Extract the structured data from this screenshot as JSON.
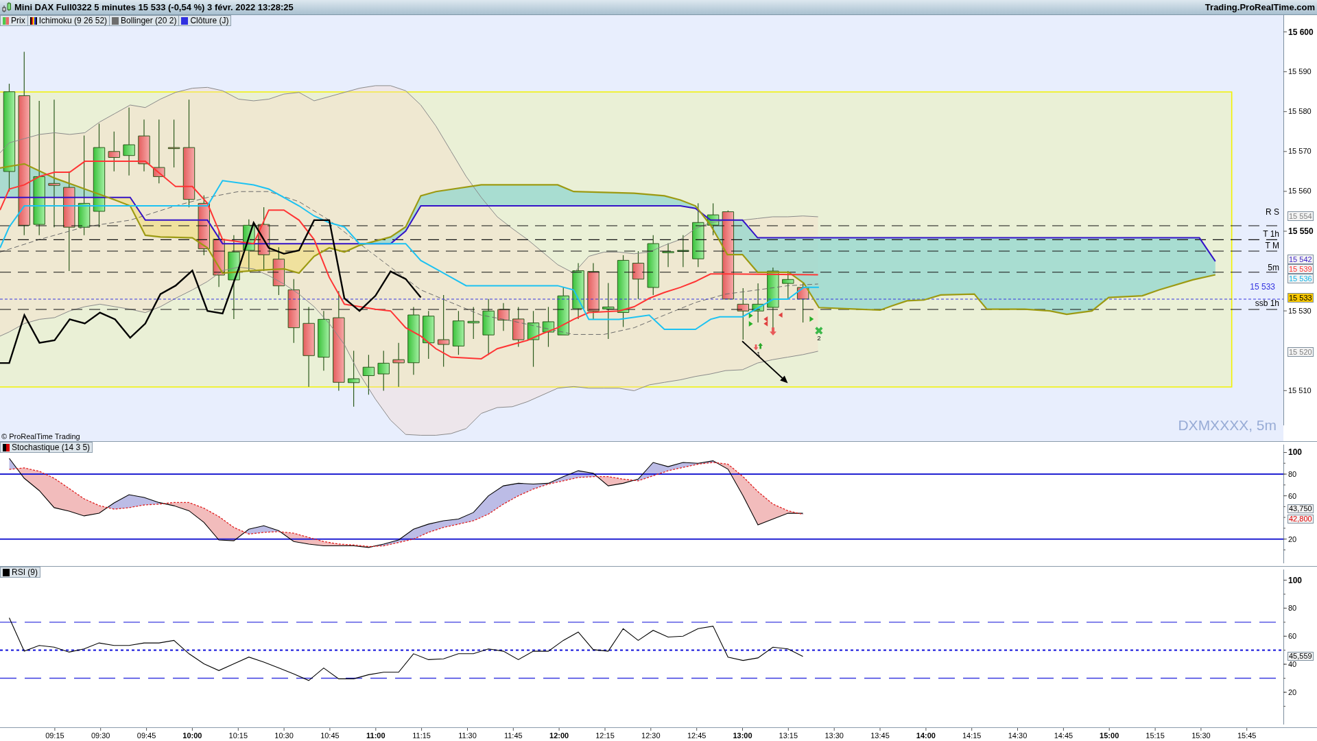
{
  "window": {
    "title": "Mini DAX Full0322 5 minutes 15 533 (-0,54 %) 3 févr. 2022 13:28:25",
    "site": "Trading.ProRealTime.com"
  },
  "price_panel": {
    "legend": [
      {
        "label": "Prix",
        "kind": "price"
      },
      {
        "label": "Ichimoku (9 26 52)",
        "kind": "ichimoku"
      },
      {
        "label": "Bollinger (20 2)",
        "kind": "bollinger"
      },
      {
        "label": "Clôture (J)",
        "kind": "close"
      }
    ],
    "levels": [
      {
        "label": "R S",
        "kind": "level"
      },
      {
        "label": "T 1h",
        "kind": "level"
      },
      {
        "label": "T M",
        "kind": "level"
      },
      {
        "label": "5m",
        "kind": "level"
      },
      {
        "label": "15 533",
        "kind": "price"
      },
      {
        "label": "ssb 1h",
        "kind": "level"
      }
    ],
    "signal_labels": [
      "1",
      "2"
    ],
    "copyright": "© ProRealTime Trading",
    "symbol_label": "DXMXXXX, 5m",
    "axis_labels": [
      {
        "label": "15 600",
        "bold": true
      },
      {
        "label": "15 590",
        "bold": false
      },
      {
        "label": "15 580",
        "bold": false
      },
      {
        "label": "15 570",
        "bold": false
      },
      {
        "label": "15 560",
        "bold": false
      },
      {
        "label": "15 550",
        "bold": true
      },
      {
        "label": "15 530",
        "bold": false
      },
      {
        "label": "15 510",
        "bold": false
      }
    ],
    "value_tags": [
      {
        "label": "15 554",
        "kind": "line",
        "color": "#808080"
      },
      {
        "label": "15 542",
        "kind": "line",
        "color": "#3a1fc4"
      },
      {
        "label": "15 539",
        "kind": "line",
        "color": "#ff3030"
      },
      {
        "label": "15 536",
        "kind": "line",
        "color": "#10b4e8"
      },
      {
        "label": "15 533",
        "kind": "current",
        "color": "#f9c900"
      },
      {
        "label": "15 520",
        "kind": "line",
        "color": "#808080"
      }
    ]
  },
  "stochastic_panel": {
    "legend": {
      "label": "Stochastique (14 3 5)",
      "kind": "stochastic"
    },
    "value_tags": [
      {
        "label": "43,750",
        "color": "#000000"
      },
      {
        "label": "42,800",
        "color": "#e00000"
      }
    ],
    "chart_data": {
      "type": "line",
      "ylim": [
        -4.9,
        109.8
      ],
      "yticks": [
        {
          "value": 20,
          "label": "20"
        },
        {
          "value": 60,
          "label": "60"
        },
        {
          "value": 80,
          "label": "80"
        },
        {
          "value": 100,
          "label": "100"
        }
      ],
      "series": [
        {
          "color": "#000000",
          "line_style": "solid",
          "values": [
            94.6,
            76.2,
            64.8,
            49.0,
            45.8,
            41.4,
            43.9,
            53.4,
            61.0,
            58.5,
            53.8,
            50.8,
            46.2,
            35.4,
            19.2,
            18.5,
            29.2,
            32.3,
            27.7,
            17.7,
            15.4,
            13.8,
            13.8,
            13.8,
            12.3,
            15.4,
            19.2,
            29.2,
            33.8,
            36.9,
            38.5,
            44.6,
            60,
            69.2,
            71.5,
            70.8,
            71.5,
            77.7,
            83.1,
            80.8,
            69.2,
            71.5,
            75.4,
            90.8,
            86.9,
            90.8,
            90,
            92.3,
            84.6,
            60,
            33.1,
            38.5,
            43.8,
            43.8
          ]
        },
        {
          "color": "#e02020",
          "line_style": "dashed",
          "values": [
            84.4,
            85.7,
            82.6,
            76.2,
            66.7,
            57.2,
            50.9,
            47.7,
            49,
            51.5,
            52.3,
            53.8,
            53.8,
            48.5,
            40.8,
            30.8,
            24.6,
            26.2,
            26.9,
            25.4,
            21.5,
            17.7,
            15.4,
            14.6,
            13.1,
            13.8,
            16.9,
            20,
            26.2,
            30.8,
            33.8,
            36.9,
            43.1,
            52.3,
            60,
            66.2,
            70.8,
            73.8,
            76.9,
            77.7,
            77.7,
            75.4,
            73.8,
            78.5,
            83.1,
            86.2,
            89.2,
            90.8,
            89.2,
            77.7,
            63.8,
            52.3,
            46.2,
            42.8
          ]
        }
      ],
      "ref_lines": [
        {
          "axis": "y",
          "value": 80
        },
        {
          "axis": "y",
          "value": 20
        }
      ]
    }
  },
  "rsi_panel": {
    "legend": {
      "label": "RSI (9)",
      "kind": "rsi"
    },
    "value_tags": [
      {
        "label": "45,559",
        "color": "#000000"
      }
    ],
    "chart_data": {
      "type": "line",
      "ylim": [
        -5,
        109.6
      ],
      "yticks": [
        {
          "value": 20,
          "label": "20"
        },
        {
          "value": 40,
          "label": "40"
        },
        {
          "value": 60,
          "label": "60"
        },
        {
          "value": 80,
          "label": "80"
        },
        {
          "value": 100,
          "label": "100"
        }
      ],
      "series": [
        {
          "color": "#000000",
          "line_style": "solid",
          "values": [
            73.1,
            49.3,
            53.4,
            52.2,
            48.7,
            51.0,
            55.2,
            53.4,
            53.4,
            55.2,
            55.2,
            57.0,
            47.5,
            40.3,
            35.5,
            40.3,
            45.1,
            41.5,
            37.3,
            33.1,
            28.4,
            37.3,
            29.6,
            29.6,
            32.5,
            34.3,
            34.3,
            47.5,
            43.3,
            43.9,
            47.5,
            47.5,
            51.0,
            49.3,
            43.3,
            49.3,
            49.3,
            57.0,
            63.0,
            50.4,
            49.3,
            65.4,
            57.0,
            64.2,
            59.4,
            60.0,
            65.4,
            67.2,
            45.1,
            42.7,
            44.5,
            52.2,
            51.0,
            45.6
          ]
        }
      ],
      "ref_lines": [
        {
          "axis": "y",
          "value": 70
        },
        {
          "axis": "y",
          "value": 50
        },
        {
          "axis": "y",
          "value": 30
        }
      ]
    }
  },
  "time_axis": [
    {
      "label": "09:15",
      "bold": false
    },
    {
      "label": "09:30",
      "bold": false
    },
    {
      "label": "09:45",
      "bold": false
    },
    {
      "label": "10:00",
      "bold": true
    },
    {
      "label": "10:15",
      "bold": false
    },
    {
      "label": "10:30",
      "bold": false
    },
    {
      "label": "10:45",
      "bold": false
    },
    {
      "label": "11:00",
      "bold": true
    },
    {
      "label": "11:15",
      "bold": false
    },
    {
      "label": "11:30",
      "bold": false
    },
    {
      "label": "11:45",
      "bold": false
    },
    {
      "label": "12:00",
      "bold": true
    },
    {
      "label": "12:15",
      "bold": false
    },
    {
      "label": "12:30",
      "bold": false
    },
    {
      "label": "12:45",
      "bold": false
    },
    {
      "label": "13:00",
      "bold": true
    },
    {
      "label": "13:15",
      "bold": false
    },
    {
      "label": "13:30",
      "bold": false
    },
    {
      "label": "13:45",
      "bold": false
    },
    {
      "label": "14:00",
      "bold": true
    },
    {
      "label": "14:15",
      "bold": false
    },
    {
      "label": "14:30",
      "bold": false
    },
    {
      "label": "14:45",
      "bold": false
    },
    {
      "label": "15:00",
      "bold": true
    },
    {
      "label": "15:15",
      "bold": false
    },
    {
      "label": "15:30",
      "bold": false
    },
    {
      "label": "15:45",
      "bold": false
    }
  ]
}
